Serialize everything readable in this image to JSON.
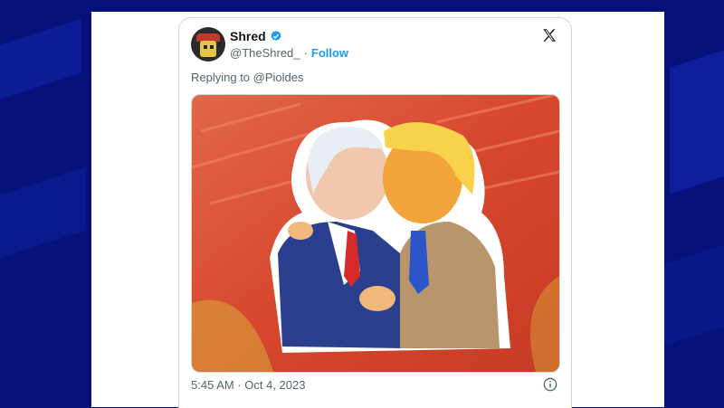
{
  "tweet": {
    "display_name": "Shred",
    "handle": "@TheShred_",
    "separator": "·",
    "follow_label": "Follow",
    "replying_prefix": "Replying to",
    "replying_to": "@Pioldes",
    "timestamp": "5:45 AM · Oct 4, 2023",
    "media_alt": "AI-generated illustration of two caricatured men in suits embracing"
  },
  "colors": {
    "background": "#06127a",
    "link": "#1d9bf0",
    "text_primary": "#0f1419",
    "text_secondary": "#536471",
    "verified": "#1d9bf0"
  },
  "icons": [
    "x-logo-icon",
    "verified-badge-icon",
    "info-icon",
    "avatar"
  ]
}
